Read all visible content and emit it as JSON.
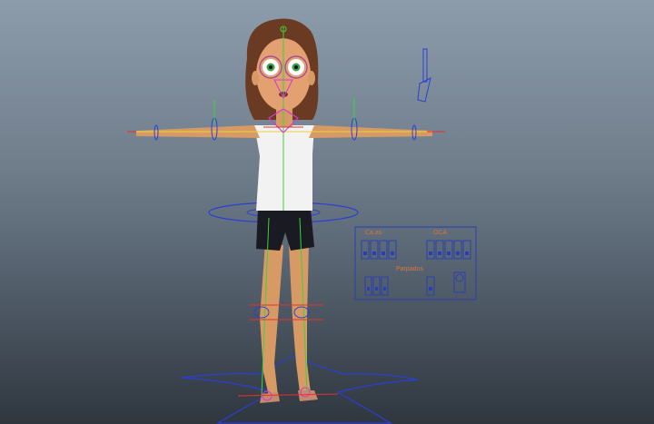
{
  "viewport": {
    "name": "3D viewport - character rig (T-pose)"
  },
  "control_panel": {
    "labels": {
      "left": "Ca as",
      "right": "OCA",
      "bottom": "Parpados"
    }
  },
  "colors": {
    "background_top": "#8d9cab",
    "background_bottom": "#2f363e",
    "rig_blue": "#2a3fd6",
    "rig_green": "#3cd23c",
    "rig_red": "#e83030",
    "rig_yellow": "#e8d23a",
    "rig_magenta": "#d23ad2",
    "panel_outline": "#2a3fb0",
    "panel_label": "#d6783a"
  }
}
